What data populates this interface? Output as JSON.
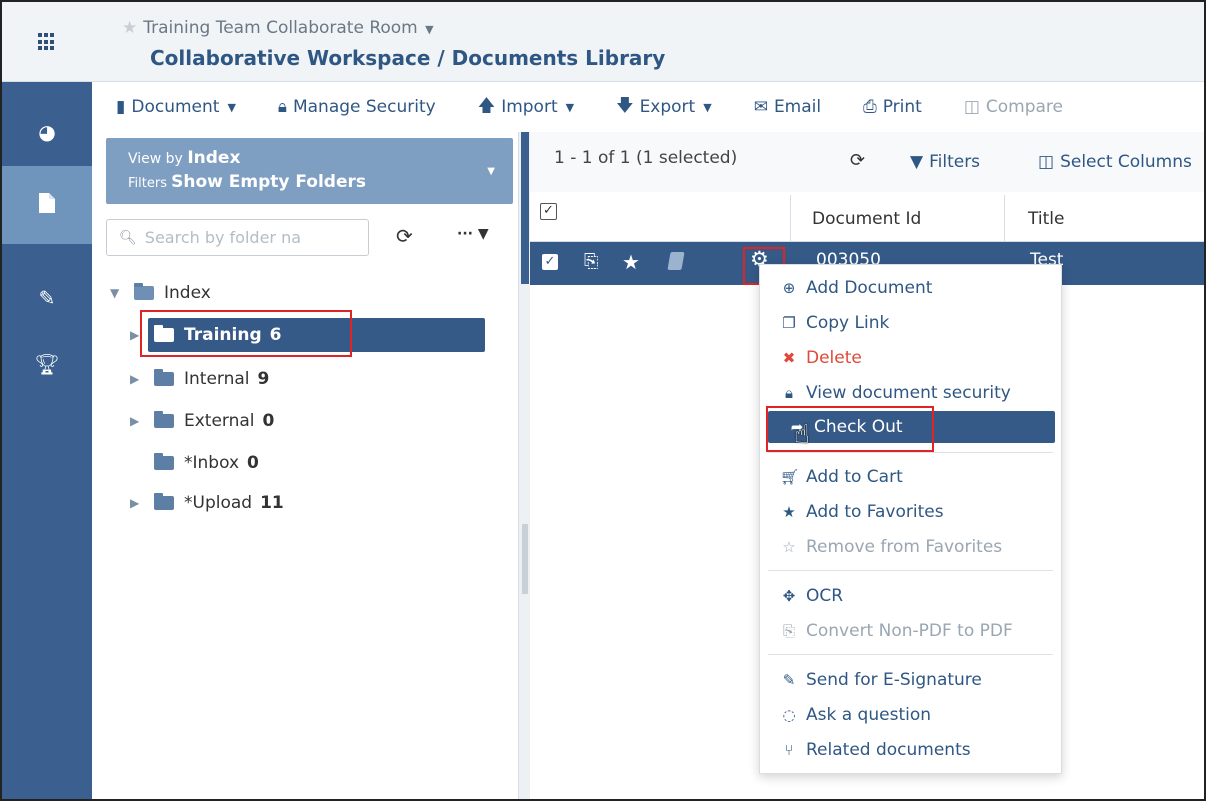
{
  "header": {
    "room": "Training Team Collaborate Room",
    "breadcrumb": "Collaborative Workspace / Documents Library"
  },
  "toolbar": {
    "document": "Document",
    "manage_security": "Manage Security",
    "import": "Import",
    "export": "Export",
    "email": "Email",
    "print": "Print",
    "compare": "Compare"
  },
  "view_box": {
    "view_by_label": "View by",
    "view_by_value": "Index",
    "filters_label": "Filters",
    "filters_value": "Show Empty Folders"
  },
  "search": {
    "placeholder": "Search by folder na"
  },
  "tree": {
    "root": "Index",
    "folders": [
      {
        "name": "Training",
        "count": "6"
      },
      {
        "name": "Internal",
        "count": "9"
      },
      {
        "name": "External",
        "count": "0"
      },
      {
        "name": "*Inbox",
        "count": "0"
      },
      {
        "name": "*Upload",
        "count": "11"
      }
    ]
  },
  "grid": {
    "count_text": "1 - 1 of 1 (1 selected)",
    "filters": "Filters",
    "select_columns": "Select Columns",
    "columns": {
      "document_id": "Document Id",
      "title": "Title"
    },
    "row": {
      "document_id": "003050",
      "title": "Test"
    }
  },
  "context_menu": {
    "items": [
      {
        "label": "Add Document",
        "icon": "plus-circle-icon"
      },
      {
        "label": "Copy Link",
        "icon": "copy-icon"
      },
      {
        "label": "Delete",
        "icon": "x-icon"
      },
      {
        "label": "View document security",
        "icon": "lock-icon"
      },
      {
        "label": "Check Out",
        "icon": "check-out-icon"
      },
      {
        "label": "Add to Cart",
        "icon": "cart-icon"
      },
      {
        "label": "Add to Favorites",
        "icon": "star-icon"
      },
      {
        "label": "Remove from Favorites",
        "icon": "star-outline-icon"
      },
      {
        "label": "OCR",
        "icon": "ocr-icon"
      },
      {
        "label": "Convert Non-PDF to PDF",
        "icon": "pdf-icon"
      },
      {
        "label": "Send for E-Signature",
        "icon": "edit-icon"
      },
      {
        "label": "Ask a question",
        "icon": "comment-icon"
      },
      {
        "label": "Related documents",
        "icon": "related-icon"
      }
    ]
  },
  "colors": {
    "rail": "#3b5f8e",
    "selected": "#355a88",
    "accent_text": "#2f5784",
    "highlight_box": "#e02424",
    "danger": "#e0483a"
  }
}
